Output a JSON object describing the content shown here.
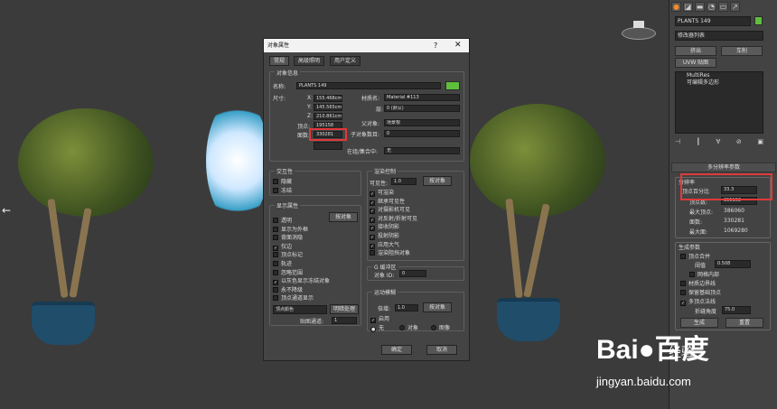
{
  "viewport": {
    "nav_arrow": "←"
  },
  "panel": {
    "tabs": [
      "●",
      "◪",
      "▬",
      "◔",
      "▭",
      "↗"
    ],
    "object_name": "PLANTS 149",
    "modifier_list": "修改器列表",
    "btn_extrude": "挤出",
    "btn_lathe": "车削",
    "btn_uvw": "UVW 贴图",
    "stack": [
      "MultiRes",
      "可编辑多边形"
    ],
    "stack_tools": [
      "⊣",
      "┃",
      "∀",
      "⊘",
      "▣"
    ],
    "rollout_title": "多分辨率参数",
    "group_resolution": "分辨率",
    "vertex_percent_label": "顶点百分比",
    "vertex_percent": "33.3",
    "vertex_count_label": "顶点数:",
    "vertex_count": "355158",
    "max_vertex_label": "最大顶点:",
    "max_vertex": "386060",
    "face_count_label": "面数:",
    "face_count": "330281",
    "max_face_label": "最大面:",
    "max_face": "1069280",
    "group_generate": "生成参数",
    "vertex_merge": "顶点合并",
    "threshold_label": "阈值",
    "threshold": "0.508",
    "within_mesh": "网格内部",
    "keep_boundary": "材质边界线",
    "keep_base_vertices": "保留基础顶点",
    "multi_vertex_normals": "多顶点法线",
    "crease_angle_label": "折缝角度",
    "crease_angle": "75.0",
    "btn_generate": "生成",
    "btn_reset": "重置"
  },
  "dialog": {
    "title": "对象属性",
    "help": "?",
    "close": "✕",
    "tabs": [
      "常规",
      "高级照明",
      "用户定义"
    ],
    "object_info_label": "对象信息",
    "name_label": "名称:",
    "name_value": "PLANTS 149",
    "size_label": "尺寸:",
    "x_label": "X:",
    "x_value": "155.468cm",
    "y_label": "Y:",
    "y_value": "145.565cm",
    "z_label": "Z:",
    "z_value": "210.861cm",
    "vertices_label": "顶点:",
    "vertices_value": "195158",
    "faces_label": "面数:",
    "faces_value": "330281",
    "material_label": "材质名:",
    "material_value": "Material #113",
    "layer_label": "层:",
    "layer_value": "0 (默认)",
    "parent_label": "父对象:",
    "parent_value": "场景根",
    "children_label": "子对象数目:",
    "children_value": "0",
    "group_label": "在组/集合中:",
    "group_value": "无",
    "interactivity_label": "交互性",
    "hide": "隐藏",
    "freeze": "冻结",
    "display_props_label": "显示属性",
    "by_object": "按对象",
    "display_items": [
      "透明",
      "显示为外框",
      "背面消隐",
      "仅边",
      "顶点标记",
      "轨迹",
      "忽略范围",
      "以灰色显示冻结对象",
      "永不降级",
      "顶点通道显示"
    ],
    "display_checked": [
      false,
      false,
      false,
      true,
      false,
      false,
      false,
      true,
      false,
      false
    ],
    "vertex_color_select": "顶点颜色",
    "map_channel_label": "贴图通道:",
    "map_channel": "1",
    "shaded_btn": "明暗处理",
    "render_control_label": "渲染控制",
    "visibility_label": "可见性:",
    "visibility_value": "1.0",
    "render_by_object": "按对象",
    "render_items": [
      "可渲染",
      "继承可见性",
      "对摄影机可见",
      "对反射/折射可见",
      "接收阴影",
      "投射阴影",
      "应用大气",
      "渲染阻挡对象"
    ],
    "render_checked": [
      true,
      true,
      true,
      true,
      true,
      true,
      true,
      false
    ],
    "gbuffer_label": "G 缓冲区",
    "object_id_label": "对象 ID:",
    "object_id": "0",
    "motion_blur_label": "运动模糊",
    "multiplier_label": "倍增:",
    "multiplier_value": "1.0",
    "blur_by_object": "按对象",
    "enabled": "启用",
    "none": "无",
    "object": "对象",
    "image": "图像",
    "ok": "确定",
    "cancel": "取消"
  },
  "watermark": {
    "brand": "Bai●百度",
    "jy": "经验",
    "url": "jingyan.baidu.com"
  }
}
